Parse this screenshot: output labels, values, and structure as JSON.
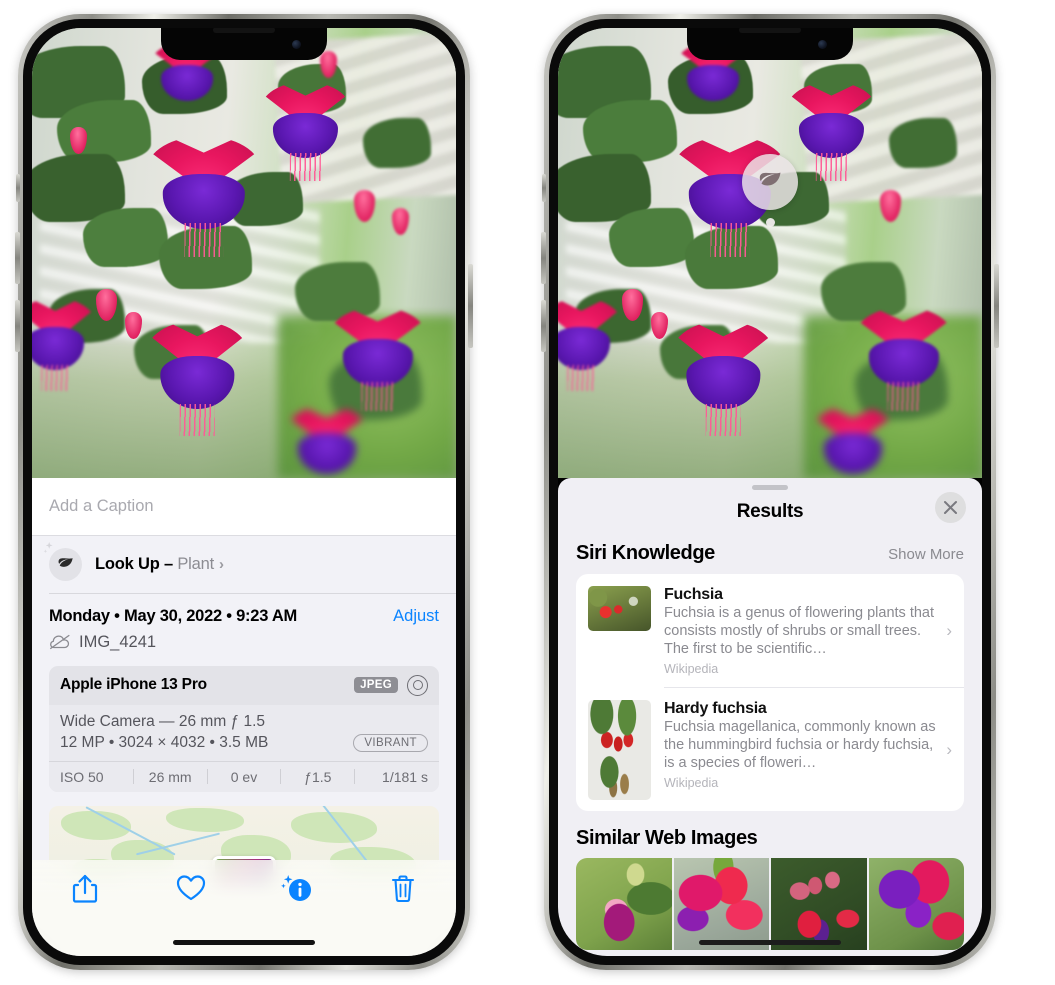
{
  "left_phone": {
    "name": "photos-detail-view",
    "caption_field": {
      "placeholder": "Add a Caption",
      "value": ""
    },
    "lookup_row": {
      "icon": "leaf-icon",
      "sparkle_icon": "sparkles-icon",
      "label": "Look Up – ",
      "subject": "Plant",
      "chevron": "›"
    },
    "metadata": {
      "date_line": "Monday • May 30, 2022 • 9:23 AM",
      "adjust_label": "Adjust",
      "cloud_icon": "icloud-slash-icon",
      "filename": "IMG_4241"
    },
    "camera_card": {
      "model": "Apple iPhone 13 Pro",
      "format_badge": "JPEG",
      "aperture_icon": "aperture-icon",
      "lens": "Wide Camera — 26 mm ƒ 1.5",
      "size_line": "12 MP • 3024 × 4032 • 3.5 MB",
      "style_badge": "VIBRANT",
      "exif": [
        "ISO 50",
        "26 mm",
        "0 ev",
        "ƒ1.5",
        "1/181 s"
      ]
    },
    "map_card": {
      "name": "location-map-thumbnail",
      "pin": "photo-pin"
    },
    "toolbar": [
      {
        "name": "share-button",
        "icon": "share-icon"
      },
      {
        "name": "favorite-button",
        "icon": "heart-icon"
      },
      {
        "name": "info-button",
        "icon": "info-sparkle-icon"
      },
      {
        "name": "delete-button",
        "icon": "trash-icon"
      }
    ]
  },
  "right_phone": {
    "name": "visual-lookup-results",
    "badge": {
      "name": "visual-lookup-badge",
      "icon": "leaf-icon"
    },
    "panel": {
      "grabber": "drag-handle",
      "title": "Results",
      "close_icon": "close-icon"
    },
    "siri_knowledge": {
      "title": "Siri Knowledge",
      "show_more": "Show More",
      "items": [
        {
          "title": "Fuchsia",
          "description": "Fuchsia is a genus of flowering plants that consists mostly of shrubs or small trees. The first to be scientific…",
          "source": "Wikipedia",
          "chevron": "›"
        },
        {
          "title": "Hardy fuchsia",
          "description": "Fuchsia magellanica, commonly known as the hummingbird fuchsia or hardy fuchsia, is a species of floweri…",
          "source": "Wikipedia",
          "chevron": "›"
        }
      ]
    },
    "similar_web_images": {
      "title": "Similar Web Images",
      "count": 4
    }
  },
  "colors": {
    "accent_blue": "#0a84ff",
    "panel_bg": "#f2f2f7",
    "results_bg": "#f0eff4",
    "card_bg": "#ffffff",
    "secondary_text": "#8a8a90",
    "badge_gray": "#8e8e94"
  }
}
